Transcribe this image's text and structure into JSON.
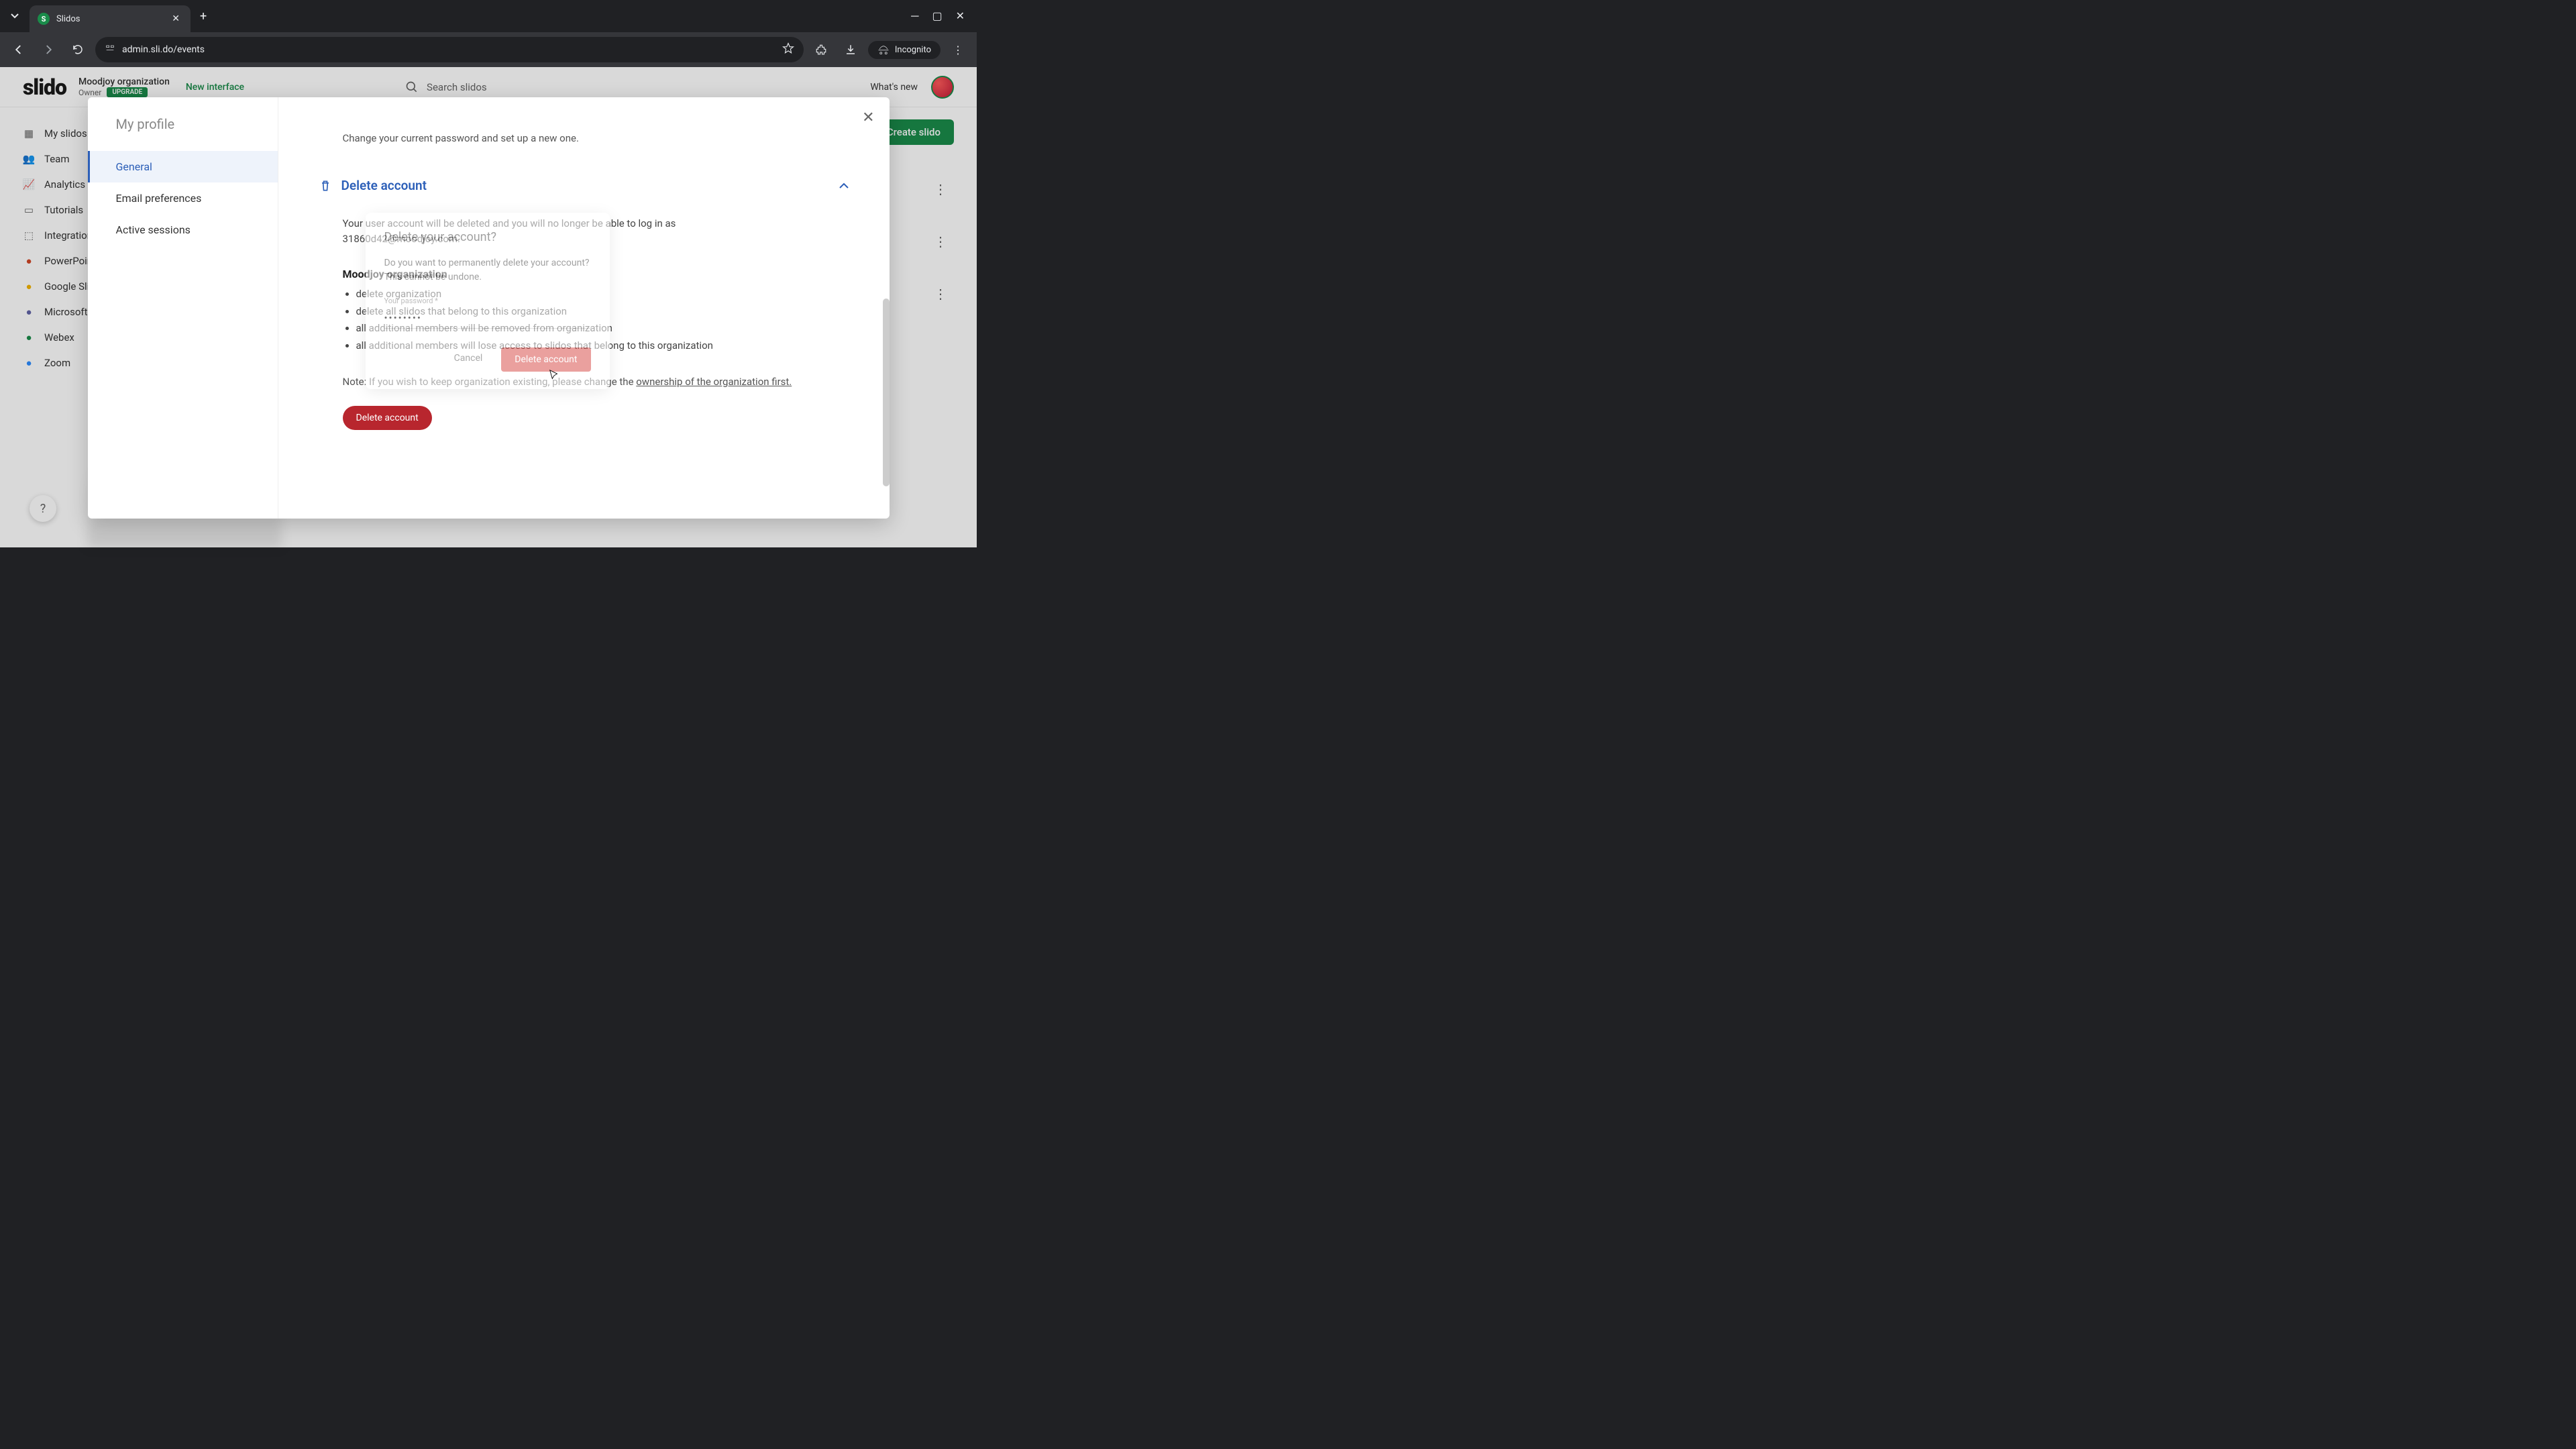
{
  "browser": {
    "tab_title": "Slidos",
    "url": "admin.sli.do/events",
    "incognito_label": "Incognito"
  },
  "header": {
    "logo": "slido",
    "org_name": "Moodjoy organization",
    "role": "Owner",
    "upgrade": "UPGRADE",
    "new_interface": "New interface",
    "search_placeholder": "Search slidos",
    "whats_new": "What's new",
    "create_btn": "Create slido"
  },
  "sidebar": {
    "items": [
      {
        "label": "My slidos",
        "icon": "calendar"
      },
      {
        "label": "Team",
        "icon": "users"
      },
      {
        "label": "Analytics",
        "icon": "chart"
      },
      {
        "label": "Tutorials",
        "icon": "book"
      },
      {
        "label": "Integrations",
        "icon": "puzzle"
      },
      {
        "label": "PowerPoint",
        "icon": "pp"
      },
      {
        "label": "Google Slides",
        "icon": "gs"
      },
      {
        "label": "Microsoft Teams",
        "icon": "mt"
      },
      {
        "label": "Webex",
        "icon": "wb"
      },
      {
        "label": "Zoom",
        "icon": "zm"
      }
    ]
  },
  "profile": {
    "title": "My profile",
    "nav": [
      {
        "label": "General"
      },
      {
        "label": "Email preferences"
      },
      {
        "label": "Active sessions"
      }
    ],
    "password_sub": "Change your current password and set up a new one.",
    "delete": {
      "heading": "Delete account",
      "desc": "Your user account will be deleted and you will no longer be able to log in as 31860d42@moodjoy.com.",
      "org": "Moodjoy organization",
      "bullets": [
        "delete organization",
        "delete all slidos that belong to this organization",
        "all additional members will be removed from organization",
        "all additional members will lose access to slidos that belong to this organization"
      ],
      "note_prefix": "Note: If you wish to keep organization existing, please change the ",
      "note_link": "ownership of the organization first.",
      "button": "Delete account"
    }
  },
  "confirm": {
    "title": "Delete your account?",
    "body": "Do you want to permanently delete your account? This cannot be undone.",
    "label": "Your password *",
    "mask": "••••••••",
    "cancel": "Cancel",
    "delete": "Delete account"
  }
}
